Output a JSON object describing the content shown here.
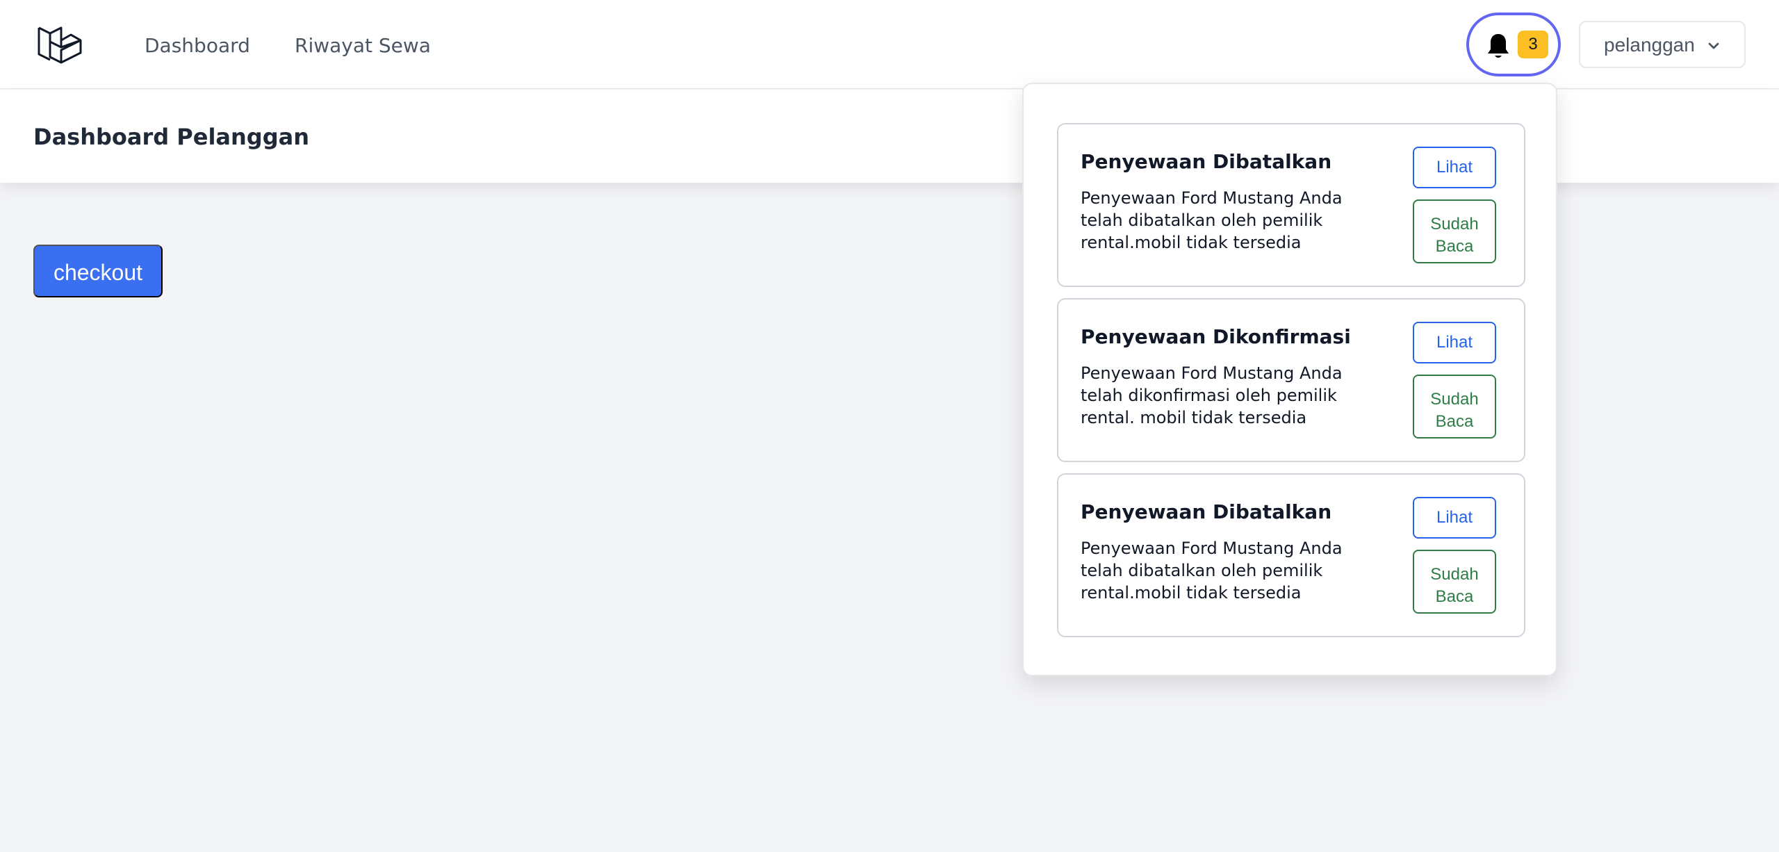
{
  "navigation": {
    "logo_icon": "laravel-logo-icon",
    "links": [
      {
        "label": "Dashboard"
      },
      {
        "label": "Riwayat Sewa"
      }
    ],
    "notification": {
      "icon": "bell-icon",
      "count": "3"
    },
    "user": {
      "name": "pelanggan",
      "dropdown_icon": "chevron-down-icon"
    }
  },
  "header": {
    "title": "Dashboard Pelanggan"
  },
  "main": {
    "checkout_label": "checkout"
  },
  "notifications": [
    {
      "title": "Penyewaan Dibatalkan",
      "message": "Penyewaan Ford Mustang Anda telah dibatalkan oleh pemilik rental.mobil tidak tersedia",
      "view_label": "Lihat",
      "read_label_line1": "Sudah",
      "read_label_line2": "Baca"
    },
    {
      "title": "Penyewaan Dikonfirmasi",
      "message": "Penyewaan Ford Mustang Anda telah dikonfirmasi oleh pemilik rental. mobil tidak tersedia",
      "view_label": "Lihat",
      "read_label_line1": "Sudah",
      "read_label_line2": "Baca"
    },
    {
      "title": "Penyewaan Dibatalkan",
      "message": "Penyewaan Ford Mustang Anda telah dibatalkan oleh pemilik rental.mobil tidak tersedia",
      "view_label": "Lihat",
      "read_label_line1": "Sudah",
      "read_label_line2": "Baca"
    }
  ],
  "colors": {
    "background": "#f3f4f6",
    "primary": "#3b6ff2",
    "focus_ring": "#6366f1",
    "badge": "#fbbf24",
    "success": "#2f7d46"
  }
}
